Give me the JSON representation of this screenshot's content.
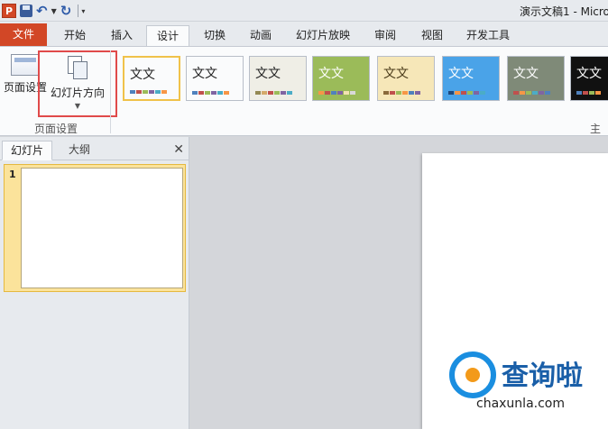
{
  "app": {
    "logo_letter": "P",
    "title": "演示文稿1 - Micro"
  },
  "tabs": [
    {
      "label": "文件"
    },
    {
      "label": "开始"
    },
    {
      "label": "插入"
    },
    {
      "label": "设计"
    },
    {
      "label": "切换"
    },
    {
      "label": "动画"
    },
    {
      "label": "幻灯片放映"
    },
    {
      "label": "审阅"
    },
    {
      "label": "视图"
    },
    {
      "label": "开发工具"
    }
  ],
  "ribbon": {
    "page_setup_label": "页面设置",
    "slide_orientation_label": "幻灯片方向",
    "group_page_setup": "页面设置",
    "group_themes": "主题",
    "themes": [
      {
        "text": "文文",
        "bg": "#ffffff",
        "fg": "#222222"
      },
      {
        "text": "文文",
        "bg": "#ffffff",
        "fg": "#222222"
      },
      {
        "text": "文文",
        "bg": "#efeee6",
        "fg": "#333333"
      },
      {
        "text": "文文",
        "bg": "#9bbb59",
        "fg": "#ffffff"
      },
      {
        "text": "文文",
        "bg": "#f6e7b8",
        "fg": "#4a3b1a"
      },
      {
        "text": "文文",
        "bg": "#4aa3e8",
        "fg": "#ffffff"
      },
      {
        "text": "文文",
        "bg": "#7f8a78",
        "fg": "#ffffff"
      },
      {
        "text": "文文",
        "bg": "#111111",
        "fg": "#ffffff"
      }
    ]
  },
  "left_panel": {
    "tab_slides": "幻灯片",
    "tab_outline": "大纲",
    "slide_number": "1"
  },
  "watermark": {
    "main": "查询啦",
    "sub": "chaxunla.com"
  }
}
